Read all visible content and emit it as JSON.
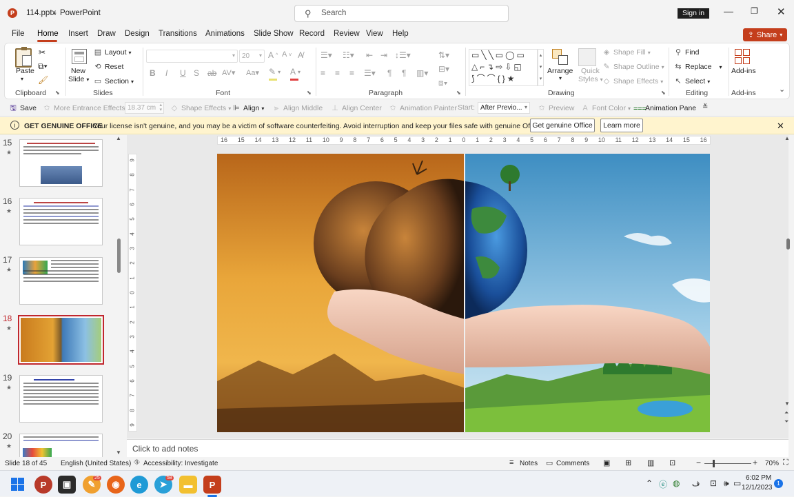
{
  "titlebar": {
    "filename": "114.pptx",
    "separator": "-",
    "app": "PowerPoint",
    "search_placeholder": "Search",
    "sign_in": "Sign in"
  },
  "menu": {
    "items": [
      "File",
      "Home",
      "Insert",
      "Draw",
      "Design",
      "Transitions",
      "Animations",
      "Slide Show",
      "Record",
      "Review",
      "View",
      "Help"
    ],
    "share": "Share"
  },
  "ribbon": {
    "clipboard": {
      "paste": "Paste",
      "group": "Clipboard"
    },
    "slides": {
      "new_slide": "New",
      "new_slide2": "Slide",
      "layout": "Layout",
      "reset": "Reset",
      "section": "Section",
      "group": "Slides"
    },
    "font": {
      "size": "20",
      "group": "Font"
    },
    "paragraph": {
      "group": "Paragraph"
    },
    "drawing": {
      "arrange": "Arrange",
      "quick_styles": "Quick",
      "quick_styles2": "Styles",
      "shape_fill": "Shape Fill",
      "shape_outline": "Shape Outline",
      "shape_effects": "Shape Effects",
      "group": "Drawing"
    },
    "editing": {
      "find": "Find",
      "replace": "Replace",
      "select": "Select",
      "group": "Editing"
    },
    "addins": {
      "label": "Add-ins",
      "group": "Add-ins"
    }
  },
  "anim_toolbar": {
    "save": "Save",
    "more_entrance": "More Entrance Effects",
    "size_value": "18.37 cm",
    "shape_effects": "Shape Effects",
    "align": "Align",
    "align_middle": "Align Middle",
    "align_center": "Align Center",
    "animation_painter": "Animation Painter",
    "start_label": "Start:",
    "start_value": "After Previo...",
    "preview": "Preview",
    "font_color": "Font Color",
    "animation_pane": "Animation Pane"
  },
  "license": {
    "title": "GET GENUINE OFFICE",
    "message": "Your license isn't genuine, and you may be a victim of software counterfeiting. Avoid interruption and keep your files safe with genuine Office today.",
    "btn_genuine": "Get genuine Office",
    "btn_learn": "Learn more"
  },
  "thumbnails": [
    {
      "num": "15",
      "star": "★"
    },
    {
      "num": "16",
      "star": "★"
    },
    {
      "num": "17",
      "star": "★"
    },
    {
      "num": "18",
      "star": "★"
    },
    {
      "num": "19",
      "star": "★"
    },
    {
      "num": "20",
      "star": "★"
    }
  ],
  "selected_slide": "18",
  "ruler": {
    "h_labels": [
      "16",
      "15",
      "14",
      "13",
      "12",
      "11",
      "10",
      "9",
      "8",
      "7",
      "6",
      "5",
      "4",
      "3",
      "2",
      "1",
      "0",
      "1",
      "2",
      "3",
      "4",
      "5",
      "6",
      "7",
      "8",
      "9",
      "10",
      "11",
      "12",
      "13",
      "14",
      "15",
      "16"
    ],
    "v_labels": [
      "9",
      "8",
      "7",
      "6",
      "5",
      "4",
      "3",
      "2",
      "1",
      "0",
      "1",
      "2",
      "3",
      "4",
      "5",
      "6",
      "7",
      "8",
      "9"
    ]
  },
  "notes_placeholder": "Click to add notes",
  "status": {
    "slide": "Slide 18 of 45",
    "language": "English (United States)",
    "accessibility": "Accessibility: Investigate",
    "notes": "Notes",
    "comments": "Comments",
    "zoom": "70%"
  },
  "taskbar": {
    "time": "6:02 PM",
    "date": "12/1/2023",
    "notif_count": "1",
    "badge_a": "25",
    "badge_b": "58"
  },
  "colors": {
    "accent": "#c43e1c",
    "selected_thumb_border": "#c0272d",
    "warning_bg": "#fff4ce"
  }
}
